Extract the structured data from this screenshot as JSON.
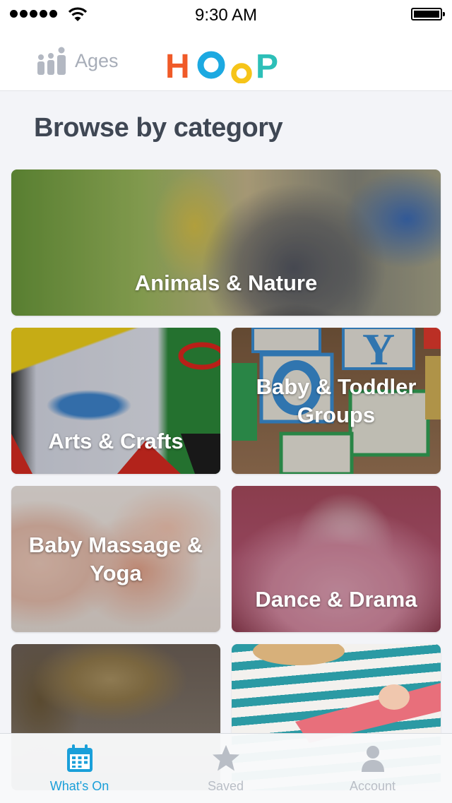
{
  "status_bar": {
    "time": "9:30 AM"
  },
  "header": {
    "ages_label": "Ages",
    "logo_letters": [
      {
        "char": "H",
        "color": "#f05a28"
      },
      {
        "char": "O",
        "color": "#1ca9e1"
      },
      {
        "char": "o",
        "color": "#f6c419"
      },
      {
        "char": "P",
        "color": "#2dbfb8"
      }
    ]
  },
  "main": {
    "title": "Browse by category",
    "categories": [
      {
        "label": "Animals & Nature",
        "icon": "rabbit-photo"
      },
      {
        "label": "Arts & Crafts",
        "icon": "paper-scissors-photo"
      },
      {
        "label": "Baby & Toddler Groups",
        "icon": "toy-blocks-photo"
      },
      {
        "label": "Baby Massage & Yoga",
        "icon": "baby-feet-photo"
      },
      {
        "label": "Dance & Drama",
        "icon": "child-shoes-photo"
      },
      {
        "label": "",
        "icon": "dinosaur-skeleton-photo"
      },
      {
        "label": "",
        "icon": "child-guitar-photo"
      }
    ]
  },
  "tabbar": {
    "active_color": "#1a9fd9",
    "inactive_color": "#b9bec6",
    "tabs": [
      {
        "label": "What's On",
        "icon": "calendar-icon",
        "active": true
      },
      {
        "label": "Saved",
        "icon": "star-icon",
        "active": false
      },
      {
        "label": "Account",
        "icon": "person-icon",
        "active": false
      }
    ]
  }
}
